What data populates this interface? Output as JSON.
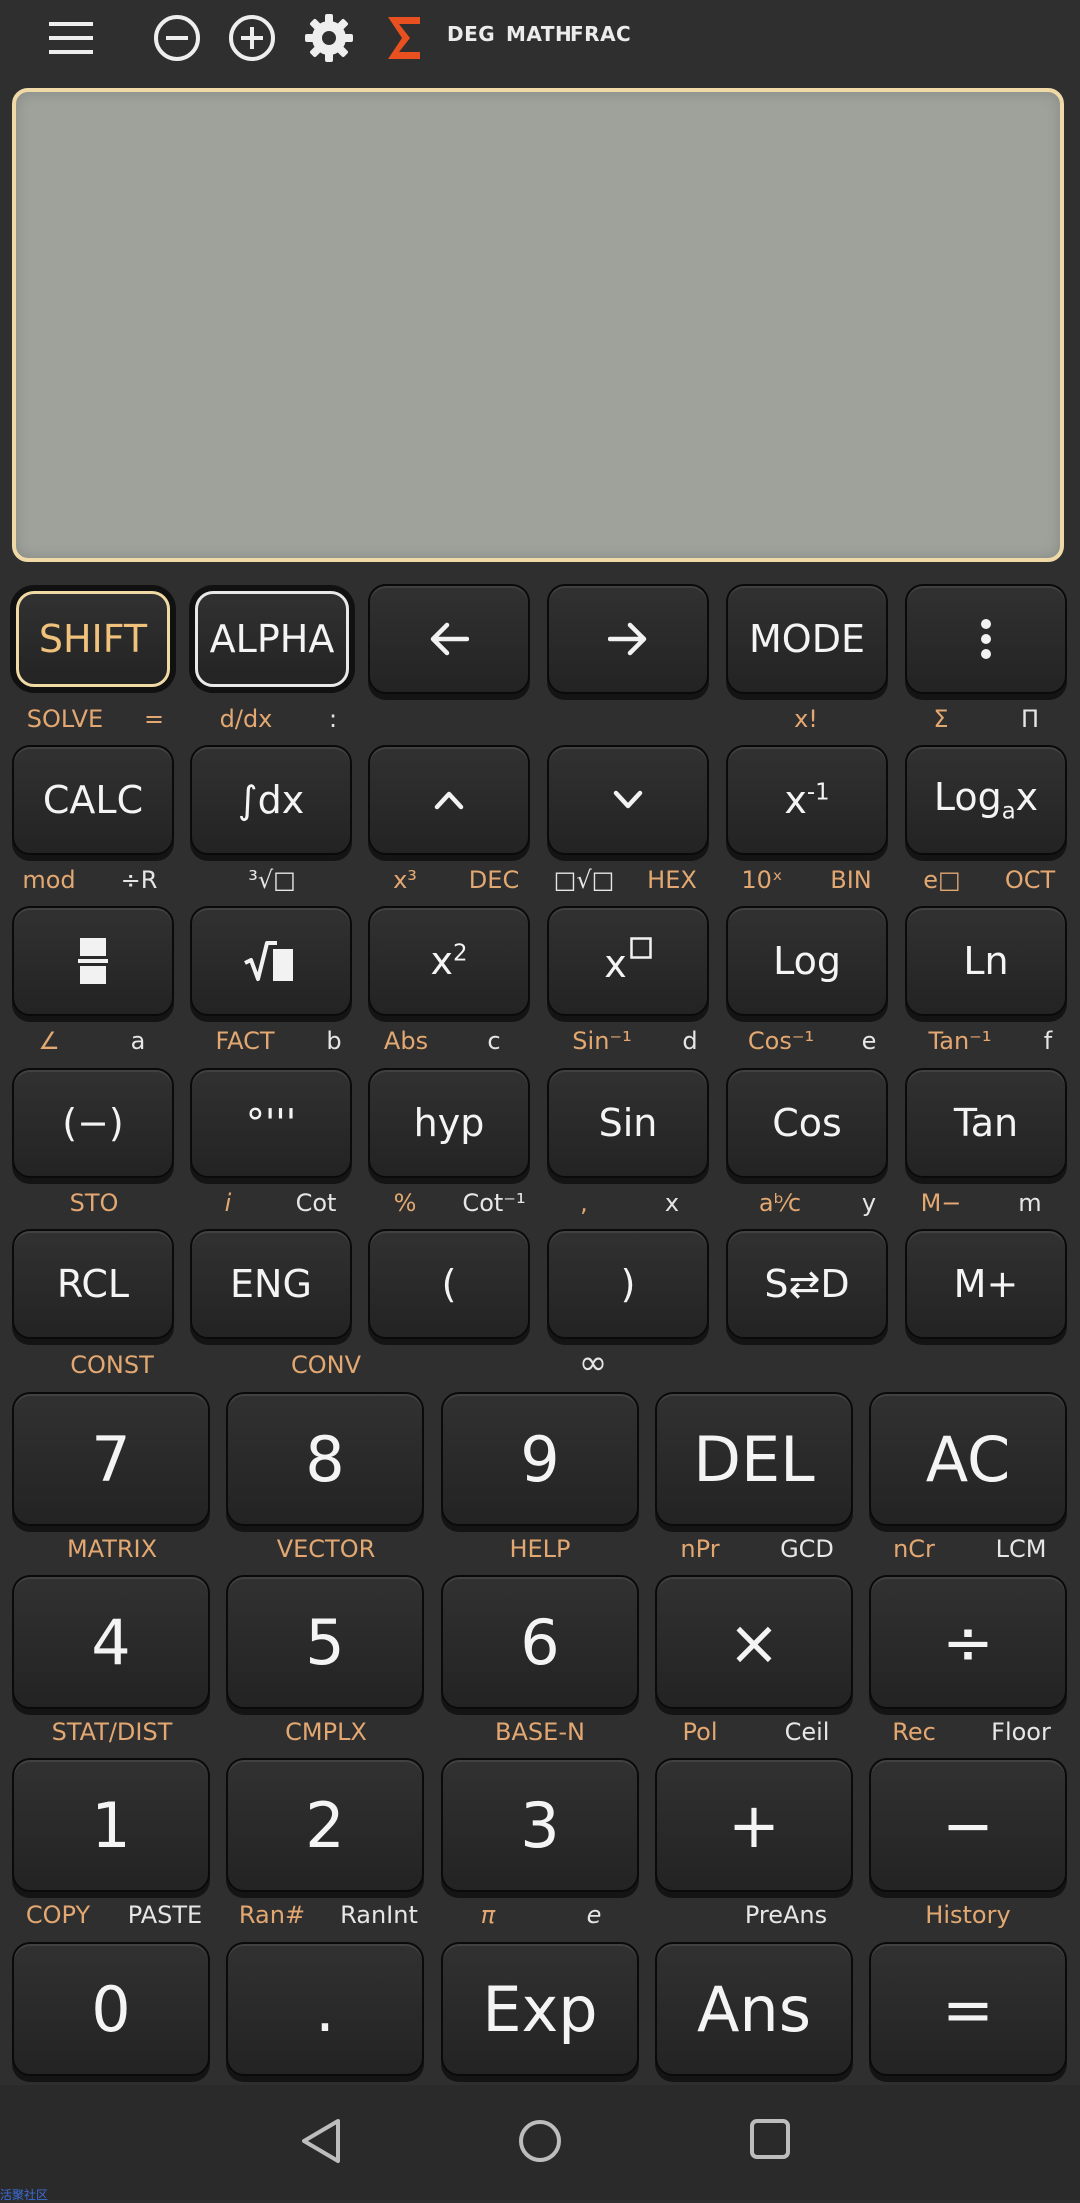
{
  "topbar": {
    "menu_icon": "hamburger-menu-icon",
    "zoom_out_icon": "minus-circle-icon",
    "zoom_in_icon": "plus-circle-icon",
    "settings_icon": "gear-icon",
    "sigma_icon": "sigma-icon",
    "angle_mode": "DEG",
    "input_mode": "MATH",
    "output_mode": "FRAC",
    "sigma_color": "#e8501f"
  },
  "display": {
    "lines": []
  },
  "keys": {
    "shift": "SHIFT",
    "alpha": "ALPHA",
    "mode": "MODE",
    "calc": "CALC",
    "integral": "∫dx",
    "inv": "x",
    "inv_sup": "-1",
    "loga": "Log",
    "loga_sub": "a",
    "loga_x": "x",
    "sq_base": "x",
    "sq_sup": "2",
    "pow_base": "x",
    "log": "Log",
    "ln": "Ln",
    "neg": "(−)",
    "dms": "°'''",
    "hyp": "hyp",
    "sin": "Sin",
    "cos": "Cos",
    "tan": "Tan",
    "rcl": "RCL",
    "eng": "ENG",
    "lparen": "(",
    "rparen": ")",
    "sd": "S⇄D",
    "mplus": "M+",
    "n7": "7",
    "n8": "8",
    "n9": "9",
    "del": "DEL",
    "ac": "AC",
    "n4": "4",
    "n5": "5",
    "n6": "6",
    "mul": "×",
    "div": "÷",
    "n1": "1",
    "n2": "2",
    "n3": "3",
    "add": "+",
    "sub": "−",
    "n0": "0",
    "dot": ".",
    "exp": "Exp",
    "ans": "Ans",
    "eq": "="
  },
  "secondary": {
    "solve": "SOLVE",
    "eq": "=",
    "ddx": "d/dx",
    "colon": ":",
    "xfact": "x!",
    "sigma": "Σ",
    "pi_prod": "Π",
    "mod": "mod",
    "divr": "÷R",
    "cbrt": "³√□",
    "x3": "x³",
    "dec": "DEC",
    "nroot": "□√□",
    "hex": "HEX",
    "tenx": "10ˣ",
    "bin": "BIN",
    "epow": "e□",
    "oct": "OCT",
    "angle": "∠",
    "a": "a",
    "fact": "FACT",
    "b": "b",
    "abs": "Abs",
    "c": "c",
    "asin": "Sin⁻¹",
    "d": "d",
    "acos": "Cos⁻¹",
    "e": "e",
    "atan": "Tan⁻¹",
    "f": "f",
    "sto": "STO",
    "i": "i",
    "cot": "Cot",
    "pct": "%",
    "acot": "Cot⁻¹",
    "comma": ",",
    "x": "x",
    "abc": "aᵇ⁄c",
    "y": "y",
    "mminus": "M−",
    "m": "m",
    "const": "CONST",
    "conv": "CONV",
    "inf": "∞",
    "matrix": "MATRIX",
    "vector": "VECTOR",
    "help": "HELP",
    "npr": "nPr",
    "gcd": "GCD",
    "ncr": "nCr",
    "lcm": "LCM",
    "stat": "STAT/DIST",
    "cmplx": "CMPLX",
    "basen": "BASE-N",
    "pol": "Pol",
    "ceil": "Ceil",
    "rec": "Rec",
    "floor": "Floor",
    "copy": "COPY",
    "paste": "PASTE",
    "ran": "Ran#",
    "ranint": "RanInt",
    "pi": "π",
    "econst": "e",
    "preans": "PreAns",
    "history": "History"
  },
  "navbar": {
    "back_icon": "back-triangle-icon",
    "home_icon": "home-circle-icon",
    "recents_icon": "recents-square-icon"
  },
  "watermark": "活聚社区"
}
